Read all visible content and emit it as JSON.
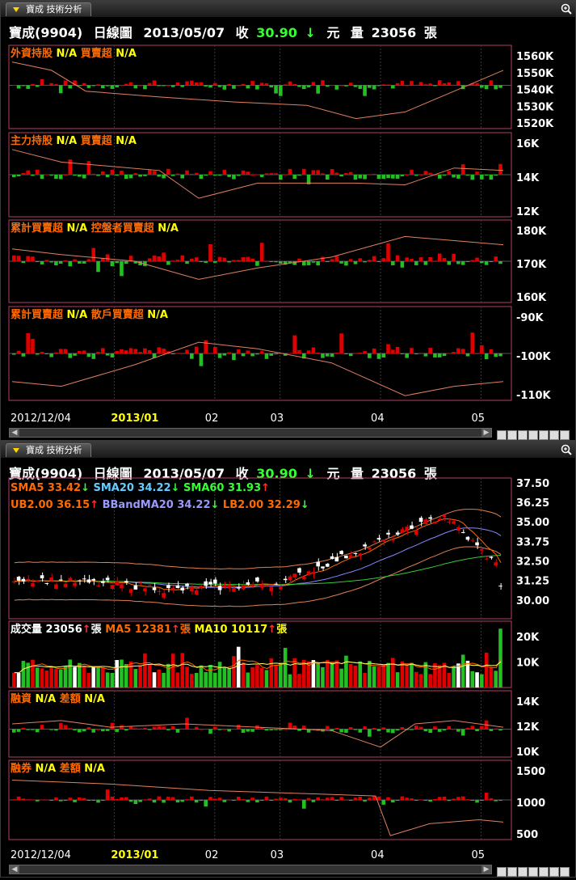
{
  "window_tab": "寶成 技術分析",
  "header": {
    "name": "寶成(9904)",
    "chart_type": "日線圖",
    "date": "2013/05/07",
    "close_label": "收",
    "close": "30.90",
    "close_unit": "元",
    "vol_label": "量",
    "volume": "23056",
    "vol_unit": "張"
  },
  "colors": {
    "up": "#e00000",
    "down": "#22c022",
    "ma_line": "#e08060",
    "frame": "#b04060",
    "grid": "#3a3a3a",
    "label_orange": "#ff6a00",
    "label_yellow": "#ffff00"
  },
  "x_labels": {
    "names": [
      "2012/12/04",
      "2013/01",
      "02",
      "03",
      "04",
      "05"
    ],
    "pos": [
      0.0,
      0.2,
      0.4,
      0.53,
      0.73,
      0.93
    ]
  },
  "chart_data": [
    {
      "type": "bar",
      "pane": "foreign",
      "legend": [
        {
          "label": "外資持股",
          "value": "N/A"
        },
        {
          "label": "買賣超",
          "value": "N/A"
        }
      ],
      "y_ticks": [
        "1560K",
        "1550K",
        "1540K",
        "1530K",
        "1520K"
      ],
      "ylim": [
        1515,
        1565
      ]
    },
    {
      "type": "bar",
      "pane": "main_force",
      "legend": [
        {
          "label": "主力持股",
          "value": "N/A"
        },
        {
          "label": "買賣超",
          "value": "N/A"
        }
      ],
      "y_ticks": [
        "16K",
        "14K",
        "12K"
      ],
      "ylim": [
        10,
        18
      ]
    },
    {
      "type": "bar",
      "pane": "controller",
      "legend": [
        {
          "label": "累計買賣超",
          "value": "N/A"
        },
        {
          "label": "控盤者買賣超",
          "value": "N/A"
        }
      ],
      "y_ticks": [
        "180K",
        "170K",
        "160K"
      ],
      "ylim": [
        155,
        188
      ]
    },
    {
      "type": "bar",
      "pane": "retail",
      "legend": [
        {
          "label": "累計買賣超",
          "value": "N/A"
        },
        {
          "label": "散戶買賣超",
          "value": "N/A"
        }
      ],
      "y_ticks": [
        "-90K",
        "-100K",
        "-110K"
      ],
      "ylim": [
        -118,
        -82
      ]
    },
    {
      "type": "line",
      "pane": "price",
      "legend_row1": [
        {
          "label": "SMA5",
          "value": "33.42",
          "dir": "down",
          "color": "#ff6a00"
        },
        {
          "label": "SMA20",
          "value": "34.22",
          "dir": "down",
          "color": "#66ccff"
        },
        {
          "label": "SMA60",
          "value": "31.93",
          "dir": "up",
          "color": "#33ff33"
        }
      ],
      "legend_row2": [
        {
          "label": "UB2.00",
          "value": "36.15",
          "dir": "up",
          "color": "#ff6a00"
        },
        {
          "label": "BBandMA20",
          "value": "34.22",
          "dir": "down",
          "color": "#9999ff"
        },
        {
          "label": "LB2.00",
          "value": "32.29",
          "dir": "down",
          "color": "#ff6a00"
        }
      ],
      "y_ticks": [
        "37.50",
        "36.25",
        "35.00",
        "33.75",
        "32.50",
        "31.25",
        "30.00"
      ],
      "ylim": [
        28.8,
        37.8
      ],
      "last_close": 30.9
    },
    {
      "type": "bar",
      "pane": "volume",
      "legend": [
        {
          "label": "成交量",
          "value": "23056",
          "dir": "up",
          "unit": "張",
          "color": "#ffffff"
        },
        {
          "label": "MA5",
          "value": "12381",
          "dir": "up",
          "unit": "張",
          "color": "#ff6a00"
        },
        {
          "label": "MA10",
          "value": "10117",
          "dir": "up",
          "unit": "張",
          "color": "#ffff00"
        }
      ],
      "y_ticks": [
        "20K",
        "10K"
      ],
      "ylim": [
        0,
        26
      ],
      "last_volume": 23056
    },
    {
      "type": "bar",
      "pane": "margin",
      "legend": [
        {
          "label": "融資",
          "value": "N/A"
        },
        {
          "label": "差額",
          "value": "N/A"
        }
      ],
      "y_ticks": [
        "14K",
        "12K",
        "10K"
      ],
      "ylim": [
        8,
        16
      ]
    },
    {
      "type": "bar",
      "pane": "short",
      "legend": [
        {
          "label": "融券",
          "value": "N/A"
        },
        {
          "label": "差額",
          "value": "N/A"
        }
      ],
      "y_ticks": [
        "1500",
        "1000",
        "500"
      ],
      "ylim": [
        300,
        1800
      ]
    }
  ]
}
